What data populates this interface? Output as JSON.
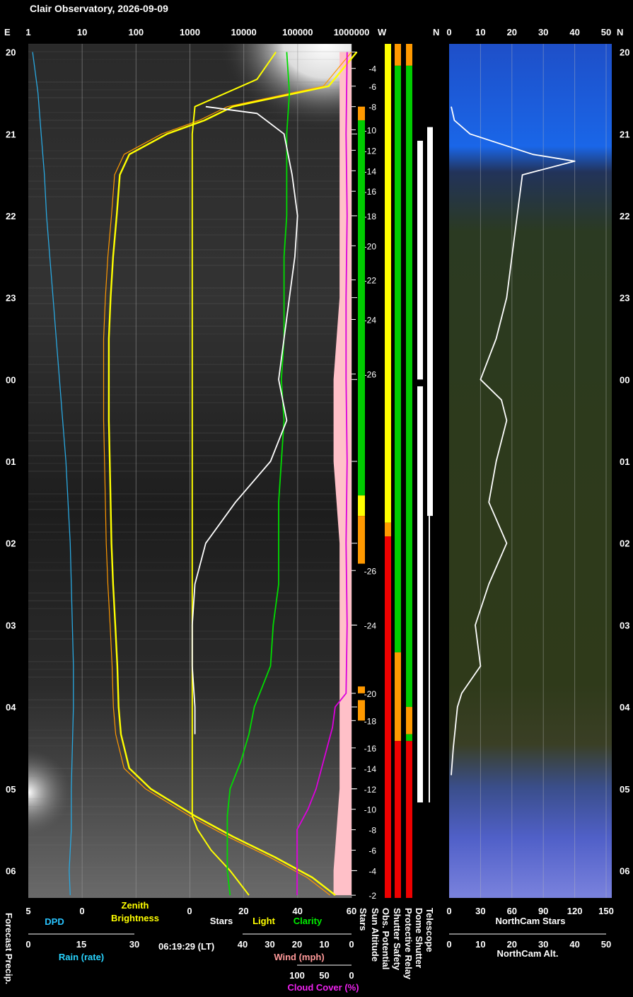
{
  "title": "Clair Observatory, 2026-09-09",
  "timestamp": "06:19:29 (LT)",
  "colors": {
    "dpd": "#29a8e0",
    "zenith": "#ffff00",
    "zenith_model": "#ff9900",
    "stars": "#ffffff",
    "light": "#ffff00",
    "clarity": "#00dd00",
    "wind": "#ff9999",
    "cloud": "#dd00dd",
    "wind_fill": "#ffc0c8",
    "ok": "#00cc00",
    "warn": "#ffff00",
    "caution": "#ff9900",
    "bad": "#ee0000"
  },
  "top_axis": {
    "left_letter": "E",
    "log_ticks": [
      "1",
      "10",
      "100",
      "1000",
      "10000",
      "100000",
      "1000000"
    ],
    "mid_w": "W",
    "mid_n": "N",
    "right_ticks": [
      "0",
      "10",
      "20",
      "30",
      "40",
      "50"
    ],
    "right_letter": "N"
  },
  "hours": [
    "20",
    "21",
    "22",
    "23",
    "00",
    "01",
    "02",
    "03",
    "04",
    "05",
    "06"
  ],
  "bottom_axis": {
    "dpd_ticks": [
      "5",
      "0"
    ],
    "dpd_label": "DPD",
    "zenith_label_1": "Zenith",
    "zenith_label_2": "Brightness",
    "sl_ticks": [
      "0",
      "20",
      "40",
      "60"
    ],
    "stars_label": "Stars",
    "light_label": "Light",
    "clarity_label": "Clarity",
    "rain_ticks": [
      "0",
      "15",
      "30"
    ],
    "rain_label": "Rain (rate)",
    "wind_ticks": [
      "40",
      "30",
      "20",
      "10",
      "0"
    ],
    "wind_label": "Wind (mph)",
    "cloud_ticks": [
      "100",
      "50",
      "0"
    ],
    "cloud_label": "Cloud Cover (%)",
    "forecast_label": "Forecast Precip.",
    "ncs_ticks": [
      "0",
      "30",
      "60",
      "90",
      "120",
      "150"
    ],
    "ncs_label": "NorthCam Stars",
    "nca_ticks": [
      "0",
      "10",
      "20",
      "30",
      "40",
      "50"
    ],
    "nca_label": "NorthCam Alt."
  },
  "status_labels": [
    "Stars",
    "Sun Altitude",
    "Obs. Potential",
    "Shutter Safety",
    "Protective Relay",
    "Dome Shutter",
    "Telescope"
  ],
  "chart_data": {
    "type": "line",
    "title": "Clair Observatory, 2026-09-09",
    "x_time_range": [
      "19:54",
      "06:20"
    ],
    "series": [
      {
        "name": "DPD",
        "units": "°C",
        "axis_range": [
          5,
          0
        ],
        "points": [
          [
            "20:00",
            4.6
          ],
          [
            "20:30",
            4.1
          ],
          [
            "21:00",
            3.8
          ],
          [
            "21:30",
            3.5
          ],
          [
            "22:00",
            3.3
          ],
          [
            "22:30",
            3.0
          ],
          [
            "23:00",
            2.7
          ],
          [
            "23:30",
            2.4
          ],
          [
            "00:00",
            2.1
          ],
          [
            "00:30",
            1.8
          ],
          [
            "01:00",
            1.5
          ],
          [
            "01:30",
            1.3
          ],
          [
            "02:00",
            1.1
          ],
          [
            "02:30",
            1.0
          ],
          [
            "03:00",
            0.9
          ],
          [
            "03:30",
            0.8
          ],
          [
            "04:00",
            0.8
          ],
          [
            "04:30",
            0.9
          ],
          [
            "05:00",
            1.0
          ],
          [
            "05:30",
            1.0
          ],
          [
            "06:00",
            1.2
          ],
          [
            "06:18",
            1.1
          ]
        ]
      },
      {
        "name": "Zenith Brightness",
        "units": "log scale",
        "axis_range": [
          1,
          1000000
        ],
        "points": [
          [
            "20:00",
            1000000
          ],
          [
            "20:25",
            300000
          ],
          [
            "20:40",
            5000
          ],
          [
            "20:50",
            1500
          ],
          [
            "21:00",
            300
          ],
          [
            "21:15",
            60
          ],
          [
            "21:30",
            40
          ],
          [
            "22:00",
            35
          ],
          [
            "22:30",
            30
          ],
          [
            "23:00",
            27
          ],
          [
            "23:30",
            25
          ],
          [
            "00:00",
            25
          ],
          [
            "00:30",
            25
          ],
          [
            "01:00",
            26
          ],
          [
            "01:30",
            27
          ],
          [
            "02:00",
            28
          ],
          [
            "02:30",
            30
          ],
          [
            "03:00",
            33
          ],
          [
            "03:30",
            36
          ],
          [
            "04:00",
            38
          ],
          [
            "04:20",
            42
          ],
          [
            "04:45",
            60
          ],
          [
            "05:00",
            150
          ],
          [
            "05:20",
            1000
          ],
          [
            "05:35",
            5000
          ],
          [
            "05:50",
            30000
          ],
          [
            "06:05",
            150000
          ],
          [
            "06:18",
            400000
          ]
        ]
      },
      {
        "name": "Stars",
        "units": "count",
        "axis_range": [
          0,
          60
        ],
        "points": [
          [
            "20:40",
            6
          ],
          [
            "20:45",
            25
          ],
          [
            "21:00",
            35
          ],
          [
            "21:30",
            38
          ],
          [
            "22:00",
            40
          ],
          [
            "22:30",
            39
          ],
          [
            "23:00",
            37
          ],
          [
            "23:30",
            35
          ],
          [
            "00:00",
            33
          ],
          [
            "00:30",
            36
          ],
          [
            "01:00",
            30
          ],
          [
            "01:30",
            17
          ],
          [
            "02:00",
            6
          ],
          [
            "02:30",
            2
          ],
          [
            "03:00",
            1
          ],
          [
            "03:30",
            1
          ],
          [
            "04:00",
            2
          ],
          [
            "04:20",
            2
          ]
        ]
      },
      {
        "name": "Light",
        "units": "sky brightness",
        "axis_range": [
          0,
          60
        ],
        "points": [
          [
            "20:00",
            32
          ],
          [
            "20:20",
            25
          ],
          [
            "20:40",
            2
          ],
          [
            "21:00",
            1
          ],
          [
            "22:00",
            1
          ],
          [
            "23:00",
            1
          ],
          [
            "00:00",
            1
          ],
          [
            "01:00",
            1
          ],
          [
            "02:00",
            1
          ],
          [
            "03:00",
            1
          ],
          [
            "04:00",
            1
          ],
          [
            "05:00",
            1
          ],
          [
            "05:20",
            1
          ],
          [
            "05:30",
            3
          ],
          [
            "05:45",
            8
          ],
          [
            "06:00",
            15
          ],
          [
            "06:18",
            22
          ]
        ]
      },
      {
        "name": "Clarity",
        "units": "index",
        "axis_range": [
          0,
          60
        ],
        "points": [
          [
            "20:00",
            36
          ],
          [
            "20:30",
            37
          ],
          [
            "21:00",
            36
          ],
          [
            "21:30",
            36
          ],
          [
            "22:00",
            36
          ],
          [
            "22:30",
            35
          ],
          [
            "23:00",
            35
          ],
          [
            "23:30",
            35
          ],
          [
            "00:00",
            34
          ],
          [
            "00:30",
            35
          ],
          [
            "01:00",
            34
          ],
          [
            "01:30",
            33
          ],
          [
            "02:00",
            33
          ],
          [
            "02:30",
            33
          ],
          [
            "03:00",
            31
          ],
          [
            "03:30",
            30
          ],
          [
            "03:45",
            27
          ],
          [
            "04:00",
            24
          ],
          [
            "04:20",
            22
          ],
          [
            "04:40",
            19
          ],
          [
            "05:00",
            15
          ],
          [
            "05:20",
            14
          ],
          [
            "05:40",
            14
          ],
          [
            "06:00",
            14
          ],
          [
            "06:18",
            15
          ]
        ]
      },
      {
        "name": "Wind (mph)",
        "units": "mph",
        "axis_range": [
          40,
          0
        ],
        "points": [
          [
            "20:00",
            2
          ],
          [
            "21:00",
            2
          ],
          [
            "22:00",
            2
          ],
          [
            "23:00",
            2
          ],
          [
            "00:00",
            3
          ],
          [
            "01:00",
            3
          ],
          [
            "02:00",
            2
          ],
          [
            "03:00",
            2
          ],
          [
            "04:00",
            2
          ],
          [
            "05:00",
            2
          ],
          [
            "06:00",
            3
          ],
          [
            "06:18",
            3
          ]
        ]
      },
      {
        "name": "Cloud Cover (%)",
        "units": "%",
        "axis_range": [
          100,
          0
        ],
        "points": [
          [
            "20:00",
            8
          ],
          [
            "21:00",
            10
          ],
          [
            "22:00",
            8
          ],
          [
            "23:00",
            10
          ],
          [
            "00:00",
            10
          ],
          [
            "01:00",
            8
          ],
          [
            "02:00",
            10
          ],
          [
            "03:00",
            8
          ],
          [
            "03:50",
            10
          ],
          [
            "04:00",
            30
          ],
          [
            "04:15",
            35
          ],
          [
            "04:30",
            45
          ],
          [
            "05:00",
            65
          ],
          [
            "05:15",
            80
          ],
          [
            "05:30",
            100
          ],
          [
            "06:18",
            100
          ]
        ]
      },
      {
        "name": "NorthCam Stars",
        "units": "count",
        "axis_range": [
          0,
          150
        ],
        "points": [
          [
            "20:40",
            2
          ],
          [
            "20:50",
            5
          ],
          [
            "21:00",
            20
          ],
          [
            "21:15",
            80
          ],
          [
            "21:20",
            120
          ],
          [
            "21:30",
            70
          ],
          [
            "22:00",
            65
          ],
          [
            "22:30",
            60
          ],
          [
            "23:00",
            55
          ],
          [
            "23:30",
            45
          ],
          [
            "00:00",
            30
          ],
          [
            "00:15",
            50
          ],
          [
            "00:30",
            55
          ],
          [
            "01:00",
            45
          ],
          [
            "01:30",
            38
          ],
          [
            "02:00",
            55
          ],
          [
            "02:30",
            38
          ],
          [
            "03:00",
            25
          ],
          [
            "03:30",
            30
          ],
          [
            "03:50",
            12
          ],
          [
            "04:00",
            8
          ],
          [
            "04:30",
            4
          ],
          [
            "04:50",
            2
          ]
        ]
      }
    ],
    "sun_altitude": {
      "units": "deg",
      "points": [
        [
          "20:12",
          -4
        ],
        [
          "20:25",
          -6
        ],
        [
          "20:40",
          -8
        ],
        [
          "20:57",
          -10
        ],
        [
          "21:12",
          -12
        ],
        [
          "21:27",
          -14
        ],
        [
          "21:42",
          -16
        ],
        [
          "22:00",
          -18
        ],
        [
          "22:22",
          -20
        ],
        [
          "22:47",
          -22
        ],
        [
          "23:16",
          -24
        ],
        [
          "23:56",
          -26
        ],
        [
          "02:20",
          -26
        ],
        [
          "03:00",
          -24
        ],
        [
          "03:50",
          -20
        ],
        [
          "04:10",
          -18
        ],
        [
          "04:30",
          -16
        ],
        [
          "04:45",
          -14
        ],
        [
          "05:00",
          -12
        ],
        [
          "05:15",
          -10
        ],
        [
          "05:30",
          -8
        ],
        [
          "05:45",
          -6
        ],
        [
          "06:00",
          -4
        ],
        [
          "06:18",
          -2
        ]
      ]
    },
    "status_bars": [
      {
        "name": "Stars",
        "segments": [
          [
            "20:40",
            "20:50",
            "caution"
          ],
          [
            "20:50",
            "01:25",
            "ok"
          ],
          [
            "01:25",
            "01:40",
            "warn"
          ],
          [
            "01:40",
            "02:15",
            "caution"
          ],
          [
            "03:45",
            "03:50",
            "caution"
          ],
          [
            "03:55",
            "04:10",
            "caution"
          ]
        ]
      },
      {
        "name": "Obs. Potential",
        "segments": [
          [
            "19:54",
            "01:45",
            "warn"
          ],
          [
            "01:45",
            "01:55",
            "caution"
          ],
          [
            "01:55",
            "06:20",
            "bad"
          ]
        ]
      },
      {
        "name": "Shutter Safety",
        "segments": [
          [
            "19:54",
            "20:10",
            "caution"
          ],
          [
            "20:10",
            "03:20",
            "ok"
          ],
          [
            "03:20",
            "04:25",
            "caution"
          ],
          [
            "04:25",
            "06:20",
            "bad"
          ]
        ]
      },
      {
        "name": "Protective Relay",
        "segments": [
          [
            "19:54",
            "20:10",
            "caution"
          ],
          [
            "20:10",
            "04:00",
            "ok"
          ],
          [
            "04:00",
            "04:20",
            "caution"
          ],
          [
            "04:20",
            "04:25",
            "ok"
          ],
          [
            "04:25",
            "06:20",
            "bad"
          ]
        ]
      },
      {
        "name": "Dome Shutter",
        "segments": [
          [
            "21:05",
            "00:00",
            "open"
          ],
          [
            "00:05",
            "05:10",
            "open"
          ]
        ]
      },
      {
        "name": "Telescope",
        "segments": [
          [
            "20:55",
            "01:40",
            "open"
          ],
          [
            "01:40",
            "05:10",
            "thin"
          ]
        ]
      }
    ]
  }
}
